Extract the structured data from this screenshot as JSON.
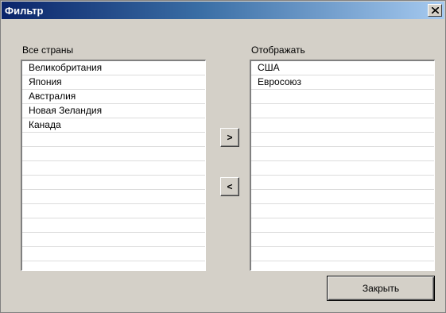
{
  "window": {
    "title": "Фильтр",
    "close_symbol": "×"
  },
  "left_list": {
    "label": "Все страны",
    "items": [
      "Великобритания",
      "Япония",
      "Австралия",
      "Новая Зеландия",
      "Канада",
      "",
      "",
      "",
      "",
      "",
      "",
      "",
      "",
      ""
    ]
  },
  "right_list": {
    "label": "Отображать",
    "items": [
      "США",
      "Евросоюз",
      "",
      "",
      "",
      "",
      "",
      "",
      "",
      "",
      "",
      "",
      "",
      ""
    ]
  },
  "buttons": {
    "move_right": ">",
    "move_left": "<",
    "close": "Закрыть"
  },
  "colors": {
    "title_start": "#0a246a",
    "title_end": "#a6caf0",
    "face": "#d4d0c8"
  }
}
